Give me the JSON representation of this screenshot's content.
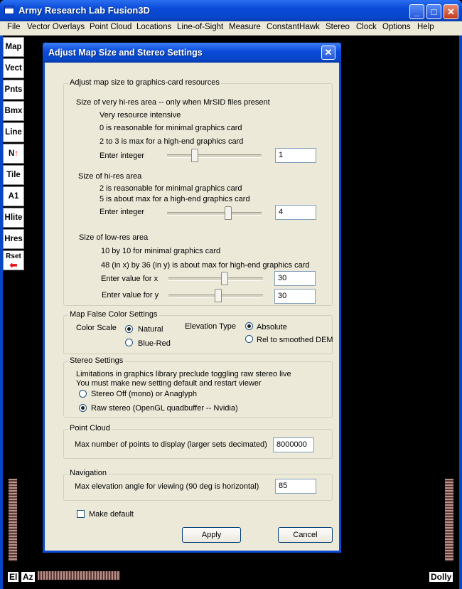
{
  "app": {
    "title": "Army Research Lab Fusion3D",
    "window_controls": {
      "minimize": "_",
      "maximize": "□",
      "close": "✕"
    }
  },
  "menu": [
    "File",
    "Vector Overlays",
    "Point Cloud",
    "Locations",
    "Line-of-Sight",
    "Measure",
    "ConstantHawk",
    "Stereo",
    "Clock",
    "Options",
    "Help"
  ],
  "toolbar": [
    "Map",
    "Vect",
    "Pnts",
    "Bmx",
    "Line",
    "N↑",
    "Tile",
    "A1",
    "Hlite",
    "Hres",
    "Rset"
  ],
  "bottom_labels": {
    "el": "El",
    "az": "Az",
    "dolly": "Dolly"
  },
  "dialog": {
    "title": "Adjust Map Size and Stereo Settings",
    "close_glyph": "✕",
    "map_size": {
      "legend": "Adjust map size to graphics-card resources",
      "very_hires": {
        "heading": "Size of very hi-res area -- only when MrSID files present",
        "note1": "Very resource intensive",
        "note2": "0 is reasonable for minimal graphics card",
        "note3": "2 to 3 is max for a high-end graphics card",
        "label": "Enter integer",
        "value": "1",
        "slider_level": 0.28
      },
      "hires": {
        "heading": "Size of hi-res area",
        "note1": "2 is reasonable for minimal graphics card",
        "note2": "5 is about max for a high-end graphics card",
        "label": "Enter integer",
        "value": "4",
        "slider_level": 0.66
      },
      "lowres": {
        "heading": "Size of low-res area",
        "note1": "10 by 10 for minimal graphics card",
        "note2": "48 (in x) by 36 (in y) is about max for high-end graphics card",
        "x_label": "Enter value for x",
        "x_value": "30",
        "x_slider_level": 0.6,
        "y_label": "Enter value for y",
        "y_value": "30",
        "y_slider_level": 0.53
      }
    },
    "false_color": {
      "legend": "Map False Color Settings",
      "color_scale_label": "Color Scale",
      "natural": "Natural",
      "blue_red": "Blue-Red",
      "color_scale_selected": "Natural",
      "elevation_type_label": "Elevation Type",
      "absolute": "Absolute",
      "rel_smoothed": "Rel to smoothed DEM",
      "elevation_selected": "Absolute"
    },
    "stereo": {
      "legend": "Stereo Settings",
      "note1": "Limitations in graphics library preclude toggling raw stereo live",
      "note2": "You must make new setting default and restart viewer",
      "option_off": "Stereo Off (mono) or Anaglyph",
      "option_raw": "Raw stereo (OpenGL quadbuffer -- Nvidia)",
      "selected": "Raw stereo (OpenGL quadbuffer -- Nvidia)"
    },
    "point_cloud": {
      "legend": "Point Cloud",
      "label": "Max number of points to display (larger sets decimated)",
      "value": "8000000"
    },
    "navigation": {
      "legend": "Navigation",
      "label": "Max elevation angle for viewing (90 deg is horizontal)",
      "value": "85"
    },
    "make_default": {
      "label": "Make default",
      "checked": false
    },
    "apply_label": "Apply",
    "cancel_label": "Cancel"
  }
}
